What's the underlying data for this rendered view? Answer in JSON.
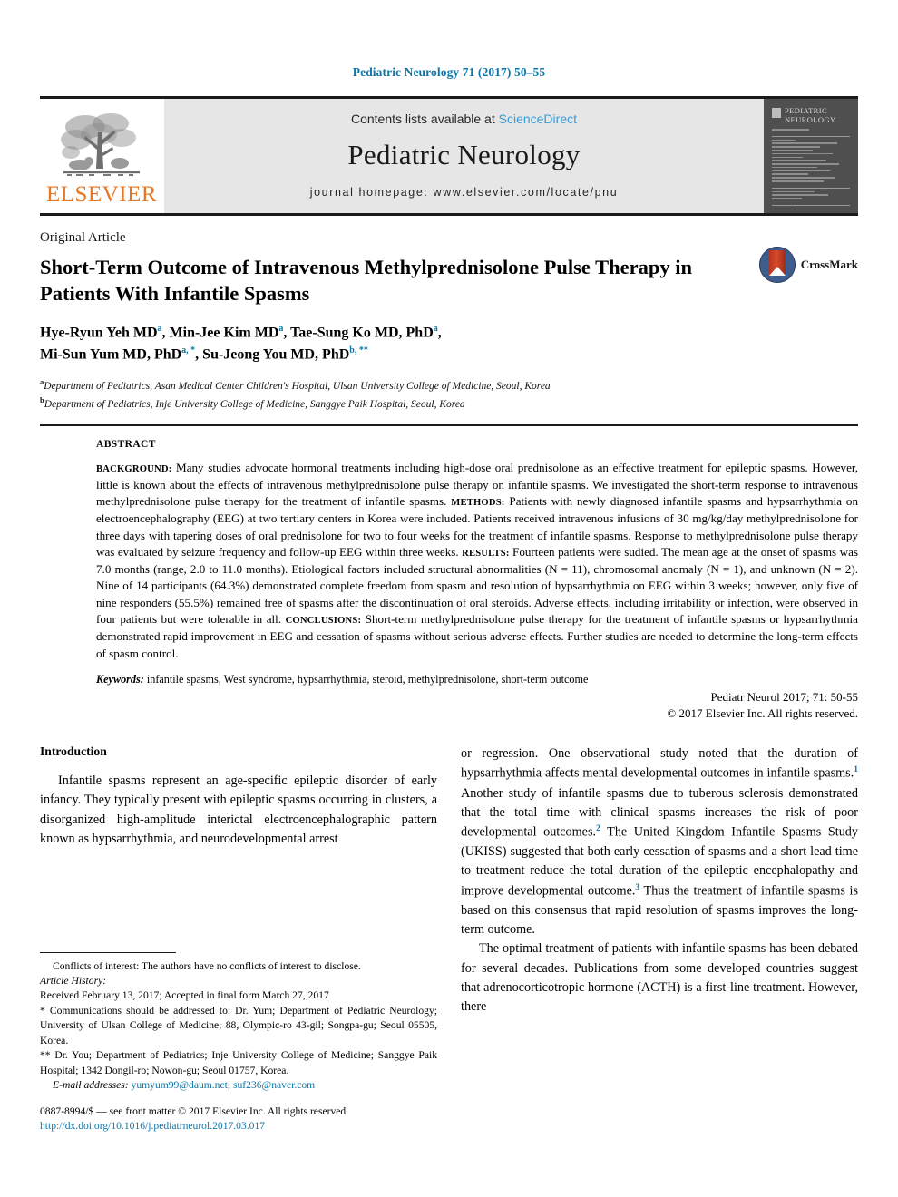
{
  "running_head": "Pediatric Neurology 71 (2017) 50–55",
  "banner": {
    "publisher": "ELSEVIER",
    "contents_prefix": "Contents lists available at ",
    "contents_link": "ScienceDirect",
    "journal_name": "Pediatric Neurology",
    "homepage": "journal homepage: www.elsevier.com/locate/pnu",
    "cover_title_line1": "PEDIATRIC",
    "cover_title_line2": "NEUROLOGY"
  },
  "article": {
    "type": "Original Article",
    "title": "Short-Term Outcome of Intravenous Methylprednisolone Pulse Therapy in Patients With Infantile Spasms",
    "crossmark_label": "CrossMark",
    "authors_line1": "Hye-Ryun Yeh MD",
    "authors_line1_sup1": "a",
    "authors_line1_b": ", Min-Jee Kim MD",
    "authors_line1_sup2": "a",
    "authors_line1_c": ", Tae-Sung Ko MD, PhD",
    "authors_line1_sup3": "a",
    "authors_line1_d": ",",
    "authors_line2": "Mi-Sun Yum MD, PhD",
    "authors_line2_sup1": "a, *",
    "authors_line2_b": ", Su-Jeong You MD, PhD",
    "authors_line2_sup2": "b, **",
    "affiliation_a_sup": "a",
    "affiliation_a": "Department of Pediatrics, Asan Medical Center Children's Hospital, Ulsan University College of Medicine, Seoul, Korea",
    "affiliation_b_sup": "b",
    "affiliation_b": "Department of Pediatrics, Inje University College of Medicine, Sanggye Paik Hospital, Seoul, Korea"
  },
  "abstract": {
    "label": "ABSTRACT",
    "sections": [
      {
        "heading": "BACKGROUND:",
        "text": " Many studies advocate hormonal treatments including high-dose oral prednisolone as an effective treatment for epileptic spasms. However, little is known about the effects of intravenous methylprednisolone pulse therapy on infantile spasms. We investigated the short-term response to intravenous methylprednisolone pulse therapy for the treatment of infantile spasms. "
      },
      {
        "heading": "METHODS:",
        "text": " Patients with newly diagnosed infantile spasms and hypsarrhythmia on electroencephalography (EEG) at two tertiary centers in Korea were included. Patients received intravenous infusions of 30 mg/kg/day methylprednisolone for three days with tapering doses of oral prednisolone for two to four weeks for the treatment of infantile spasms. Response to methylprednisolone pulse therapy was evaluated by seizure frequency and follow-up EEG within three weeks. "
      },
      {
        "heading": "RESULTS:",
        "text": " Fourteen patients were sudied. The mean age at the onset of spasms was 7.0 months (range, 2.0 to 11.0 months). Etiological factors included structural abnormalities (N = 11), chromosomal anomaly (N = 1), and unknown (N = 2). Nine of 14 participants (64.3%) demonstrated complete freedom from spasm and resolution of hypsarrhythmia on EEG within 3 weeks; however, only five of nine responders (55.5%) remained free of spasms after the discontinuation of oral steroids. Adverse effects, including irritability or infection, were observed in four patients but were tolerable in all. "
      },
      {
        "heading": "CONCLUSIONS:",
        "text": " Short-term methylprednisolone pulse therapy for the treatment of infantile spasms or hypsarrhythmia demonstrated rapid improvement in EEG and cessation of spasms without serious adverse effects. Further studies are needed to determine the long-term effects of spasm control."
      }
    ],
    "keywords_label": "Keywords:",
    "keywords": " infantile spasms, West syndrome, hypsarrhythmia, steroid, methylprednisolone, short-term outcome",
    "citation": "Pediatr Neurol 2017; 71: 50-55",
    "copyright": "© 2017 Elsevier Inc. All rights reserved."
  },
  "body": {
    "intro_heading": "Introduction",
    "left_paragraph_1": "Infantile spasms represent an age-specific epileptic disorder of early infancy. They typically present with epileptic spasms occurring in clusters, a disorganized high-amplitude interictal electroencephalographic pattern known as hypsarrhythmia, and neurodevelopmental arrest",
    "right_p1_a": "or regression. One observational study noted that the duration of hypsarrhythmia affects mental developmental outcomes in infantile spasms.",
    "right_p1_ref1": "1",
    "right_p1_b": " Another study of infantile spasms due to tuberous sclerosis demonstrated that the total time with clinical spasms increases the risk of poor developmental outcomes.",
    "right_p1_ref2": "2",
    "right_p1_c": " The United Kingdom Infantile Spasms Study (UKISS) suggested that both early cessation of spasms and a short lead time to treatment reduce the total duration of the epileptic encephalopathy and improve developmental outcome.",
    "right_p1_ref3": "3",
    "right_p1_d": " Thus the treatment of infantile spasms is based on this consensus that rapid resolution of spasms improves the long-term outcome.",
    "right_paragraph_2": "The optimal treatment of patients with infantile spasms has been debated for several decades. Publications from some developed countries suggest that adrenocorticotropic hormone (ACTH) is a first-line treatment. However, there"
  },
  "footnotes": {
    "conflicts": "Conflicts of interest: The authors have no conflicts of interest to disclose.",
    "history_label": "Article History:",
    "history": "Received February 13, 2017; Accepted in final form March 27, 2017",
    "corr1_mark": "*",
    "corr1": " Communications should be addressed to: Dr. Yum; Department of Pediatric Neurology; University of Ulsan College of Medicine; 88, Olympic-ro 43-gil; Songpa-gu; Seoul 05505, Korea.",
    "corr2_mark": "**",
    "corr2": " Dr. You; Department of Pediatrics; Inje University College of Medicine; Sanggye Paik Hospital; 1342 Dongil-ro; Nowon-gu; Seoul 01757, Korea.",
    "email_label": "E-mail addresses:",
    "email_1": "yumyum99@daum.net",
    "email_sep": "; ",
    "email_2": "suf236@naver.com"
  },
  "footer": {
    "issn_line": "0887-8994/$ — see front matter © 2017 Elsevier Inc. All rights reserved.",
    "doi": "http://dx.doi.org/10.1016/j.pediatrneurol.2017.03.017"
  },
  "colors": {
    "header_teal": "#0d76a8",
    "sciencedirect_blue": "#3a9bd6",
    "elsevier_orange": "#e87722",
    "banner_gray": "#e6e6e6",
    "cover_gray": "#4f4f4f"
  }
}
